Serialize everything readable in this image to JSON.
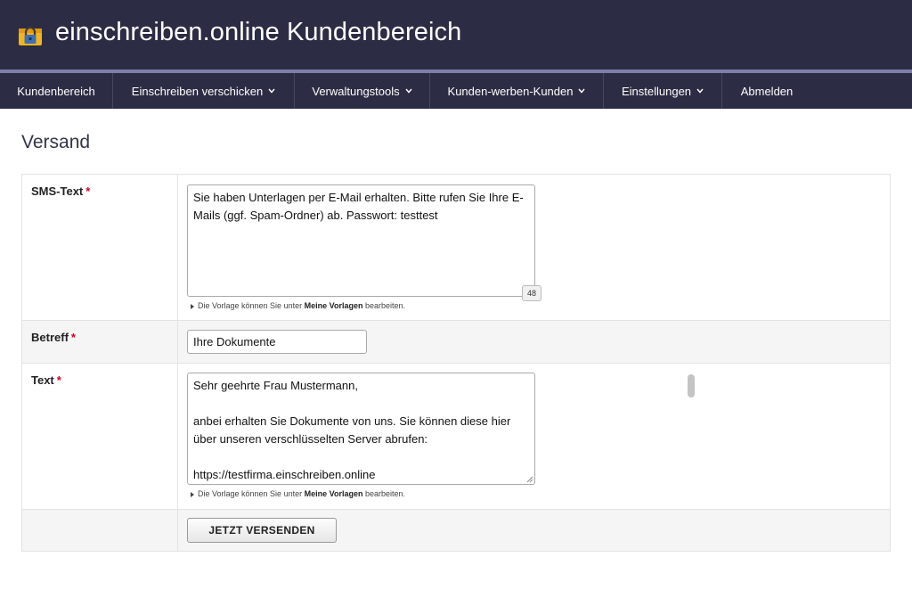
{
  "header": {
    "title": "einschreiben.online Kundenbereich",
    "logo_icon": "padlock-icon",
    "background": "#2c2c44",
    "accent": "#7b7fa8"
  },
  "nav": {
    "items": [
      {
        "label": "Kundenbereich",
        "has_dropdown": false
      },
      {
        "label": "Einschreiben verschicken",
        "has_dropdown": true
      },
      {
        "label": "Verwaltungstools",
        "has_dropdown": true
      },
      {
        "label": "Kunden-werben-Kunden",
        "has_dropdown": true
      },
      {
        "label": "Einstellungen",
        "has_dropdown": true
      },
      {
        "label": "Abmelden",
        "has_dropdown": false
      }
    ]
  },
  "page": {
    "title": "Versand"
  },
  "form": {
    "required_marker": "*",
    "sms": {
      "label": "SMS-Text",
      "value": "Sie haben Unterlagen per E-Mail erhalten. Bitte rufen Sie Ihre E-Mails (ggf. Spam-Ordner) ab. Passwort: testtest",
      "counter": "48"
    },
    "subject": {
      "label": "Betreff",
      "value": "Ihre Dokumente"
    },
    "text": {
      "label": "Text",
      "value": "Sehr geehrte Frau Mustermann,\n\nanbei erhalten Sie Dokumente von uns. Sie können diese hier über unseren verschlüsselten Server abrufen:\n\nhttps://testfirma.einschreiben.online"
    },
    "hint": {
      "prefix": "Die Vorlage können Sie unter",
      "link": "Meine Vorlagen",
      "suffix": "bearbeiten."
    },
    "submit_label": "JETZT VERSENDEN",
    "required_color": "#d0021b"
  }
}
